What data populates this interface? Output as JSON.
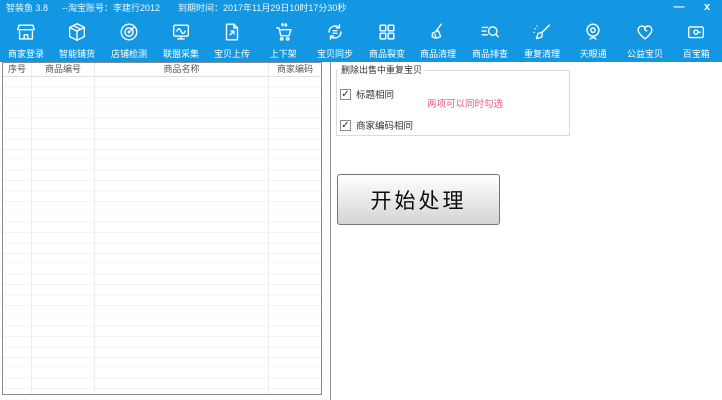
{
  "titlebar": {
    "app_title": "智装鱼  3.8",
    "account": "--淘宝账号：李建行2012",
    "expire": "到期时间：2017年11月29日10时17分30秒",
    "minimize_label": "—",
    "close_label": "x"
  },
  "toolbar": {
    "items": [
      {
        "label": "商家登录",
        "icon": "storefront-icon"
      },
      {
        "label": "智能铺货",
        "icon": "package-icon"
      },
      {
        "label": "店铺检测",
        "icon": "radar-icon"
      },
      {
        "label": "联盟采集",
        "icon": "monitor-wave-icon"
      },
      {
        "label": "宝贝上传",
        "icon": "doc-upload-icon"
      },
      {
        "label": "上下架",
        "icon": "cart-icon"
      },
      {
        "label": "宝贝同步",
        "icon": "sync-icon"
      },
      {
        "label": "商品裂变",
        "icon": "grid-icon"
      },
      {
        "label": "商品清理",
        "icon": "broom-icon"
      },
      {
        "label": "商品排查",
        "icon": "search-list-icon"
      },
      {
        "label": "重复清理",
        "icon": "brush-icon"
      },
      {
        "label": "天眼通",
        "icon": "webcam-icon"
      },
      {
        "label": "公益宝贝",
        "icon": "heart-icon"
      },
      {
        "label": "百宝箱",
        "icon": "toolbox-icon"
      }
    ]
  },
  "table": {
    "headers": [
      "序号",
      "商品编号",
      "商品名称",
      "商家编码"
    ],
    "rows": []
  },
  "panel": {
    "group_title": "删除出售中重复宝贝",
    "checkboxes": [
      {
        "label": "标题相同",
        "checked": true,
        "check_glyph": "✓"
      },
      {
        "label": "商家编码相同",
        "checked": true,
        "check_glyph": "✓"
      }
    ],
    "hint": "两项可以同时勾选",
    "start_button_label": "开始处理"
  },
  "colors": {
    "accent_blue": "#1497e2",
    "hint_red": "#f2577a"
  }
}
